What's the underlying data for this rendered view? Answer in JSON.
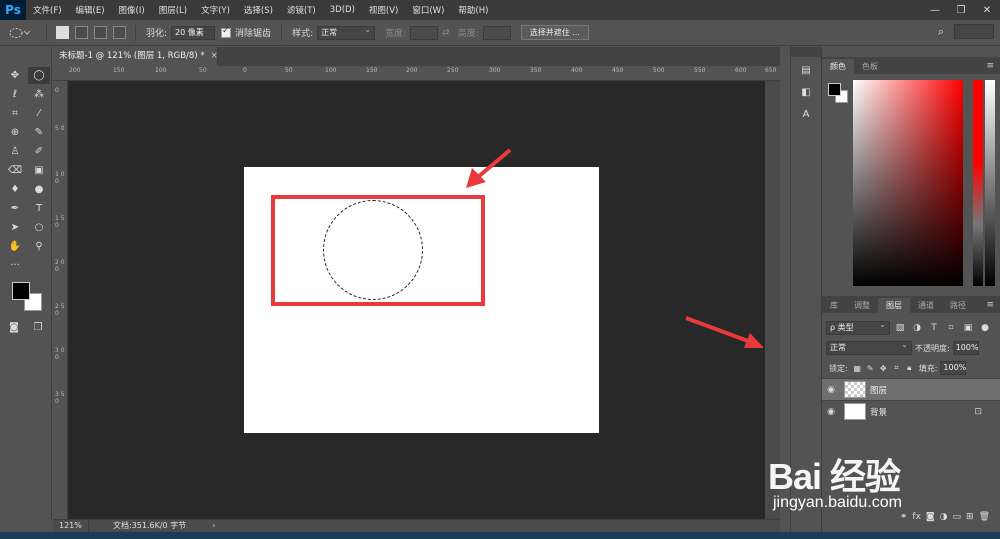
{
  "app": {
    "logo": "Ps"
  },
  "menu": [
    "文件(F)",
    "编辑(E)",
    "图像(I)",
    "图层(L)",
    "文字(Y)",
    "选择(S)",
    "滤镜(T)",
    "3D(D)",
    "视图(V)",
    "窗口(W)",
    "帮助(H)"
  ],
  "window_controls": {
    "minimize": "—",
    "restore": "❐",
    "close": "✕"
  },
  "options": {
    "feather_label": "羽化:",
    "feather_value": "20 像素",
    "antialias_label": "消除锯齿",
    "style_label": "样式:",
    "style_value": "正常",
    "width_label": "宽度:",
    "height_label": "高度:",
    "select_mask_button": "选择并遮住 ..."
  },
  "document": {
    "tab_title": "未标题-1 @ 121% (图层 1, RGB/8) *",
    "close": "×"
  },
  "rulers": {
    "h_ticks": [
      "200",
      "150",
      "100",
      "50",
      "0",
      "50",
      "100",
      "150",
      "200",
      "250",
      "300",
      "350",
      "400",
      "450",
      "500",
      "550",
      "600",
      "650"
    ],
    "v_ticks": [
      "0",
      "5 0",
      "1 0 0",
      "1 5 0",
      "2 0 0",
      "2 5 0",
      "3 0 0",
      "3 5 0"
    ]
  },
  "status": {
    "zoom": "121%",
    "doc": "文档:351.6K/0 字节",
    "arrow": "›"
  },
  "color_panel": {
    "tabs": [
      "颜色",
      "色板"
    ],
    "menu": "≡"
  },
  "layers_panel": {
    "tabs": [
      "库",
      "调整",
      "图层",
      "通道",
      "路径"
    ],
    "menu": "≡",
    "filter_label": "ρ 类型",
    "blend_mode": "正常",
    "opacity_label": "不透明度:",
    "opacity_value": "100%",
    "lock_label": "锁定:",
    "fill_label": "填充:",
    "fill_value": "100%",
    "layers": [
      {
        "name": "图层",
        "selected": true
      },
      {
        "name": "背景",
        "selected": false
      }
    ]
  },
  "watermark": {
    "logo": "Bai 经验",
    "url": "jingyan.baidu.com"
  }
}
